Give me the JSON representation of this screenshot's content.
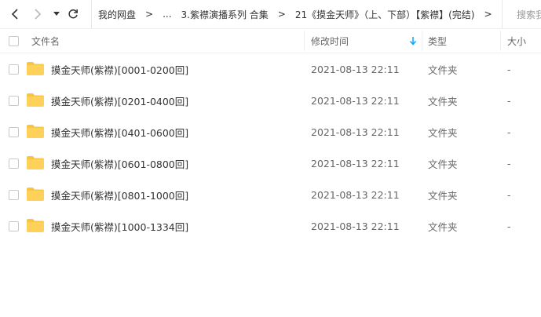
{
  "toolbar": {
    "back_icon": "chevron-left-icon",
    "forward_icon": "chevron-right-icon",
    "history_icon": "caret-down-icon",
    "refresh_icon": "refresh-icon",
    "breadcrumb": [
      "我的网盘",
      "...",
      "3.紫襟演播系列 合集",
      "21《摸金天师》（上、下部）【紫襟】(完结)"
    ],
    "separator": ">",
    "search_placeholder": "搜索我"
  },
  "columns": {
    "name": "文件名",
    "modified": "修改时间",
    "type": "类型",
    "size": "大小",
    "sort_icon": "sort-down-arrow-icon"
  },
  "files": [
    {
      "name": "摸金天师(紫襟)[0001-0200回]",
      "modified": "2021-08-13 22:11",
      "type": "文件夹",
      "size": "-"
    },
    {
      "name": "摸金天师(紫襟)[0201-0400回]",
      "modified": "2021-08-13 22:11",
      "type": "文件夹",
      "size": "-"
    },
    {
      "name": "摸金天师(紫襟)[0401-0600回]",
      "modified": "2021-08-13 22:11",
      "type": "文件夹",
      "size": "-"
    },
    {
      "name": "摸金天师(紫襟)[0601-0800回]",
      "modified": "2021-08-13 22:11",
      "type": "文件夹",
      "size": "-"
    },
    {
      "name": "摸金天师(紫襟)[0801-1000回]",
      "modified": "2021-08-13 22:11",
      "type": "文件夹",
      "size": "-"
    },
    {
      "name": "摸金天师(紫襟)[1000-1334回]",
      "modified": "2021-08-13 22:11",
      "type": "文件夹",
      "size": "-"
    }
  ],
  "colors": {
    "accent": "#06a7ff",
    "folder": "#fdd15a",
    "folder_tab": "#f7c444"
  }
}
